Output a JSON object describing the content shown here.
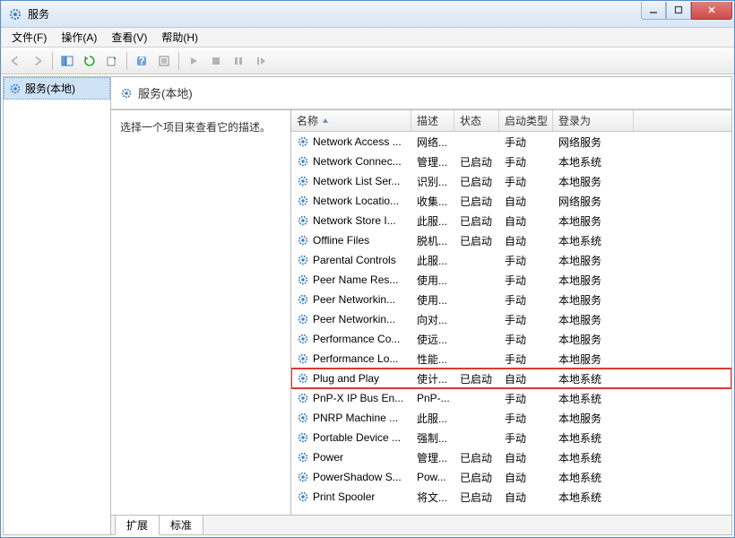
{
  "window": {
    "title": "服务"
  },
  "menubar": {
    "file": "文件(F)",
    "action": "操作(A)",
    "view": "查看(V)",
    "help": "帮助(H)"
  },
  "left_pane": {
    "root_label": "服务(本地)"
  },
  "right_pane": {
    "header": "服务(本地)",
    "description_hint": "选择一个项目来查看它的描述。"
  },
  "columns": {
    "name": "名称",
    "desc": "描述",
    "status": "状态",
    "start": "启动类型",
    "logon": "登录为"
  },
  "tabs": {
    "extended": "扩展",
    "standard": "标准"
  },
  "highlighted_name": "Plug and Play",
  "services": [
    {
      "name": "Network Access ...",
      "desc": "网络...",
      "status": "",
      "start": "手动",
      "logon": "网络服务"
    },
    {
      "name": "Network Connec...",
      "desc": "管理...",
      "status": "已启动",
      "start": "手动",
      "logon": "本地系统"
    },
    {
      "name": "Network List Ser...",
      "desc": "识别...",
      "status": "已启动",
      "start": "手动",
      "logon": "本地服务"
    },
    {
      "name": "Network Locatio...",
      "desc": "收集...",
      "status": "已启动",
      "start": "自动",
      "logon": "网络服务"
    },
    {
      "name": "Network Store I...",
      "desc": "此服...",
      "status": "已启动",
      "start": "自动",
      "logon": "本地服务"
    },
    {
      "name": "Offline Files",
      "desc": "脱机...",
      "status": "已启动",
      "start": "自动",
      "logon": "本地系统"
    },
    {
      "name": "Parental Controls",
      "desc": "此服...",
      "status": "",
      "start": "手动",
      "logon": "本地服务"
    },
    {
      "name": "Peer Name Res...",
      "desc": "使用...",
      "status": "",
      "start": "手动",
      "logon": "本地服务"
    },
    {
      "name": "Peer Networkin...",
      "desc": "使用...",
      "status": "",
      "start": "手动",
      "logon": "本地服务"
    },
    {
      "name": "Peer Networkin...",
      "desc": "向对...",
      "status": "",
      "start": "手动",
      "logon": "本地服务"
    },
    {
      "name": "Performance Co...",
      "desc": "使远...",
      "status": "",
      "start": "手动",
      "logon": "本地服务"
    },
    {
      "name": "Performance Lo...",
      "desc": "性能...",
      "status": "",
      "start": "手动",
      "logon": "本地服务"
    },
    {
      "name": "Plug and Play",
      "desc": "使计...",
      "status": "已启动",
      "start": "自动",
      "logon": "本地系统"
    },
    {
      "name": "PnP-X IP Bus En...",
      "desc": "PnP-...",
      "status": "",
      "start": "手动",
      "logon": "本地系统"
    },
    {
      "name": "PNRP Machine ...",
      "desc": "此服...",
      "status": "",
      "start": "手动",
      "logon": "本地服务"
    },
    {
      "name": "Portable Device ...",
      "desc": "强制...",
      "status": "",
      "start": "手动",
      "logon": "本地系统"
    },
    {
      "name": "Power",
      "desc": "管理...",
      "status": "已启动",
      "start": "自动",
      "logon": "本地系统"
    },
    {
      "name": "PowerShadow S...",
      "desc": "Pow...",
      "status": "已启动",
      "start": "自动",
      "logon": "本地系统"
    },
    {
      "name": "Print Spooler",
      "desc": "将文...",
      "status": "已启动",
      "start": "自动",
      "logon": "本地系统"
    }
  ]
}
